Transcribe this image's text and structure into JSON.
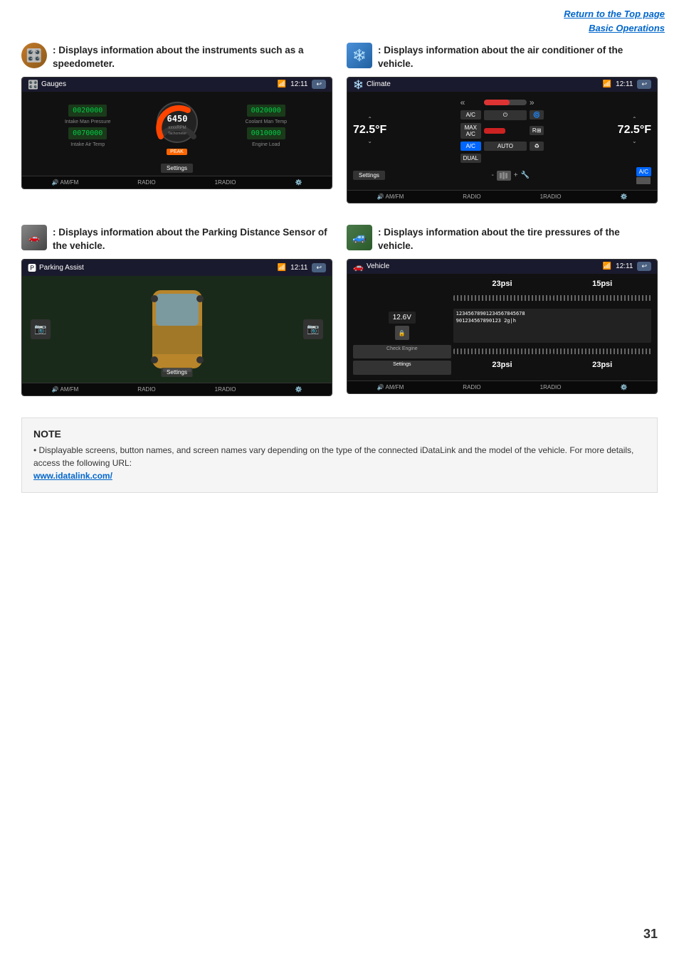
{
  "header": {
    "link1": "Return to the Top page",
    "link2": "Basic Operations"
  },
  "sections": [
    {
      "id": "gauges",
      "icon_label": "gauges-icon",
      "description": ": Displays information about the instruments such as a speedometer.",
      "screen_title": "Gauges",
      "screen_time": "12:11",
      "screen_values": {
        "top_left": "0020000",
        "top_right": "0020000",
        "rpm": "6450",
        "rpm_label": "xxxxRPM",
        "rpm_sub": "Tachometer",
        "bottom_left": "0070000",
        "bottom_right": "0010000",
        "label_tl": "Intake Man Pressure",
        "label_tr": "Coolant Man Temp",
        "label_bl": "Intake Air Temp",
        "label_br": "Engine Load",
        "peak": "PEAK"
      },
      "nav": [
        "AM/FM",
        "RADIO",
        "1RADIO"
      ]
    },
    {
      "id": "climate",
      "icon_label": "climate-icon",
      "description": ": Displays information about the air conditioner of the vehicle.",
      "screen_title": "Climate",
      "screen_time": "12:11",
      "screen_temps": {
        "left": "72.5",
        "right": "72.5",
        "unit": "°F"
      },
      "nav": [
        "AM/FM",
        "RADIO",
        "1RADIO"
      ]
    },
    {
      "id": "parking",
      "icon_label": "parking-icon",
      "description": ": Displays information about the Parking Distance Sensor of the vehicle.",
      "screen_title": "Parking Assist",
      "screen_time": "12:11",
      "nav": [
        "AM/FM",
        "RADIO",
        "1RADIO"
      ],
      "settings_label": "Settings"
    },
    {
      "id": "vehicle",
      "icon_label": "vehicle-icon",
      "description": ": Displays information about the tire pressures of the vehicle.",
      "screen_title": "Vehicle",
      "screen_time": "12:11",
      "tire_pressures": {
        "front_left": "23psi",
        "front_right": "15psi",
        "rear_left": "23psi",
        "rear_right": "23psi"
      },
      "battery": "12.6V",
      "vin1": "12345678901234567845678",
      "vin2": "901234567890123 2g|h",
      "check_engine": "Check Engine",
      "settings_label": "Settings",
      "nav": [
        "AM/FM",
        "RADIO",
        "1RADIO"
      ]
    }
  ],
  "note": {
    "title": "NOTE",
    "text": "• Displayable screens, button names, and screen names vary depending on the type of the connected iDataLink and the model of the vehicle. For more details, access the following URL:",
    "link_text": "www.idatalink.com/",
    "link_url": "http://www.idatalink.com/"
  },
  "page_number": "31"
}
